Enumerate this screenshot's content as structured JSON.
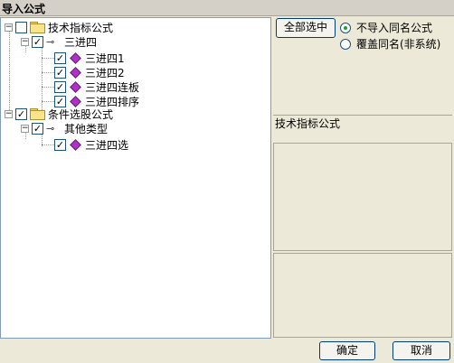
{
  "window": {
    "title": "导入公式"
  },
  "tree": {
    "nodes": [
      {
        "label": "技术指标公式",
        "checked": false,
        "expanded": true,
        "icon": "folder-icon"
      },
      {
        "label": "三进四",
        "checked": true,
        "expanded": true,
        "icon": "key-icon"
      },
      {
        "label": "三进四1",
        "checked": true,
        "icon": "formula-icon"
      },
      {
        "label": "三进四2",
        "checked": true,
        "icon": "formula-icon"
      },
      {
        "label": "三进四连板",
        "checked": true,
        "icon": "formula-icon"
      },
      {
        "label": "三进四排序",
        "checked": true,
        "icon": "formula-icon"
      },
      {
        "label": "条件选股公式",
        "checked": true,
        "expanded": true,
        "icon": "folder-icon"
      },
      {
        "label": "其他类型",
        "checked": true,
        "expanded": true,
        "icon": "key-icon"
      },
      {
        "label": "三进四选",
        "checked": true,
        "icon": "formula-icon"
      }
    ]
  },
  "options": {
    "select_all_label": "全部选中",
    "radio_skip_label": "不导入同名公式",
    "radio_overwrite_label": "覆盖同名(非系统)",
    "selected": "skip"
  },
  "detail": {
    "category_label": "技术指标公式"
  },
  "footer": {
    "ok_label": "确定",
    "cancel_label": "取消"
  }
}
